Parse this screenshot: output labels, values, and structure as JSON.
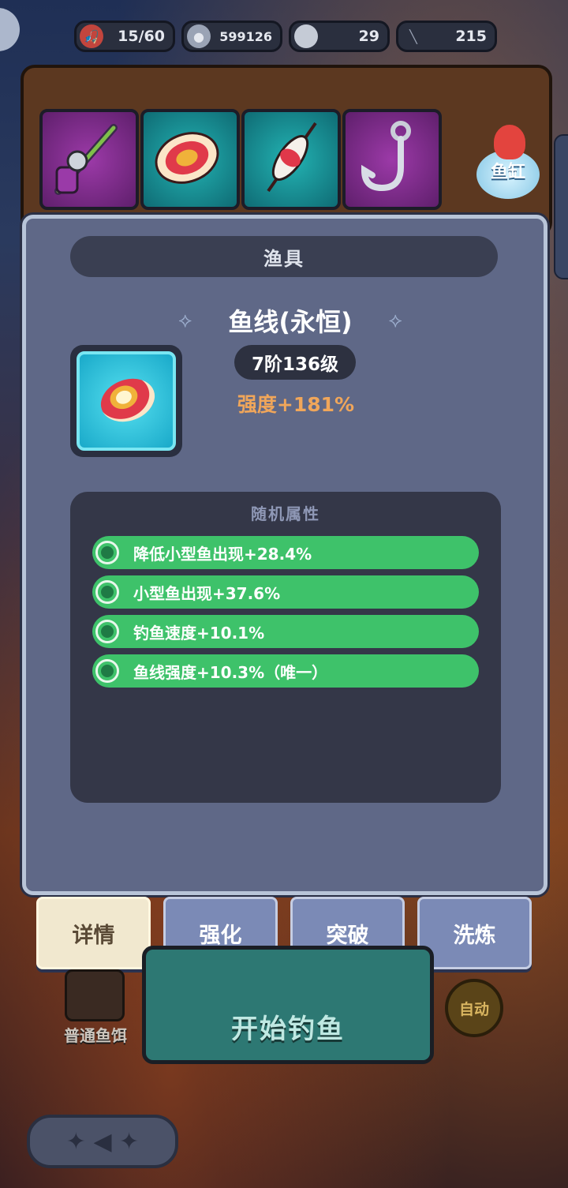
{
  "topbar": {
    "fish_count": "15/60",
    "coins": "599126",
    "pearls": "29",
    "rods": "215"
  },
  "fishtank": {
    "label": "鱼缸"
  },
  "modal": {
    "title": "渔具",
    "item_name": "鱼线(永恒)",
    "level": "7阶136级",
    "strength": "强度+181%",
    "attr_title": "随机属性",
    "attributes": [
      "降低小型鱼出现+28.4%",
      "小型鱼出现+37.6%",
      "钓鱼速度+10.1%",
      "鱼线强度+10.3%（唯一）"
    ]
  },
  "tabs": {
    "detail": "详情",
    "enhance": "强化",
    "breakthrough": "突破",
    "refine": "洗炼"
  },
  "game": {
    "start_label": "开始钓鱼",
    "bait_label": "普通鱼饵",
    "auto_label": "自动"
  },
  "icons": [
    "fisherman-icon",
    "coin-icon",
    "pearl-icon",
    "rod-icon",
    "fishing-rod-icon",
    "fishing-line-icon",
    "float-icon",
    "hook-icon",
    "fishtank-icon",
    "spool-icon",
    "back-icon"
  ]
}
